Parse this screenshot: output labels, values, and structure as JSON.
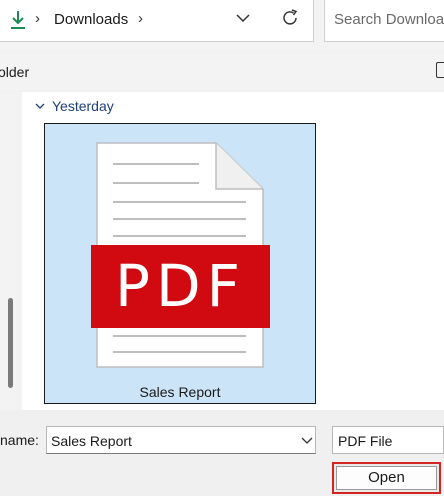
{
  "address_bar": {
    "icon": "download-arrow-icon",
    "separator": "›",
    "location": "Downloads",
    "trailing_separator": "›"
  },
  "search": {
    "placeholder": "Search Downloads"
  },
  "command_bar": {
    "new_folder_label": "older"
  },
  "group": {
    "label": "Yesterday"
  },
  "file_tile": {
    "name": "Sales Report",
    "badge_text": "PDF",
    "selected": true
  },
  "file_name": {
    "label": "name:",
    "value": "Sales Report"
  },
  "file_type": {
    "value": "PDF File"
  },
  "buttons": {
    "open_label": "Open"
  },
  "colors": {
    "pdf_red": "#d10a11",
    "selection": "#cce4f7",
    "header_blue": "#1f3f7a",
    "highlight_border": "#d42525",
    "download_green": "#1e8a4f"
  }
}
